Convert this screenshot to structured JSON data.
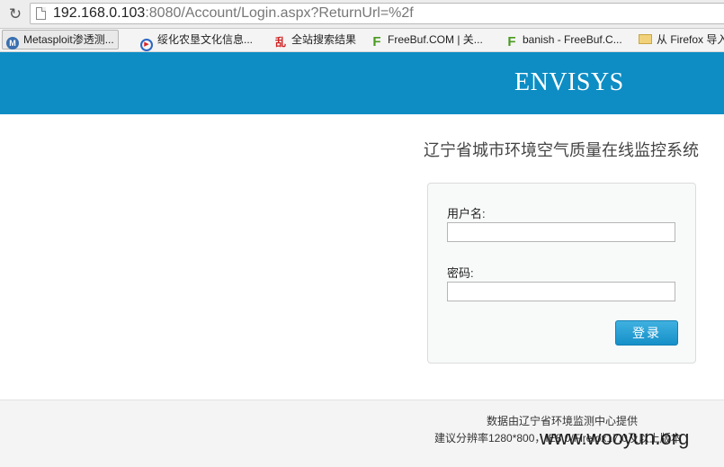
{
  "browser": {
    "url_host": "192.168.0.103",
    "url_rest": ":8080/Account/Login.aspx?ReturnUrl=%2f",
    "bookmarks": [
      {
        "label": "Metasploit渗透测...",
        "icon": "metasploit-icon"
      },
      {
        "label": "绥化农垦文化信息...",
        "icon": "play-circle-icon"
      },
      {
        "label": "全站搜索结果",
        "icon": "red-glyph-icon"
      },
      {
        "label": "FreeBuf.COM | 关...",
        "icon": "freebuf-icon"
      },
      {
        "label": "banish - FreeBuf.C...",
        "icon": "freebuf-icon"
      },
      {
        "label": "从 Firefox 导入",
        "icon": "folder-icon"
      }
    ]
  },
  "header": {
    "brand": "ENVISYS",
    "background": "#0d8dc4"
  },
  "system_title": "辽宁省城市环境空气质量在线监控系统",
  "login": {
    "username_label": "用户名:",
    "username_value": "",
    "password_label": "密码:",
    "password_value": "",
    "submit_label": "登录"
  },
  "footer": {
    "line1": "数据由辽宁省环境监测中心提供",
    "line2": "建议分辨率1280*800，IE8.0/Firefox17.0及以上版本",
    "watermark": "www.wooyun.org"
  }
}
